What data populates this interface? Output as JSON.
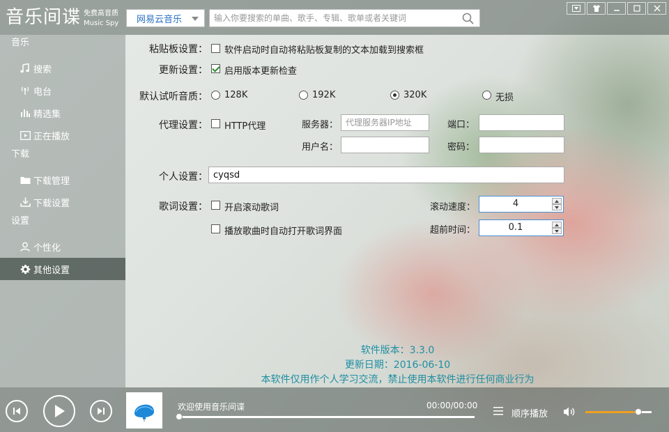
{
  "app": {
    "logo_main": "音乐间谍",
    "logo_sub1": "免费高音质",
    "logo_sub2": "Music Spy"
  },
  "header": {
    "source_selected": "网易云音乐",
    "search_placeholder": "输入你要搜索的单曲、歌手、专辑、歌单或者关键词"
  },
  "sidebar": {
    "sections": [
      {
        "title": "音乐",
        "items": [
          {
            "label": "搜索",
            "icon": "music-note-icon"
          },
          {
            "label": "电台",
            "icon": "radio-icon"
          },
          {
            "label": "精选集",
            "icon": "bars-icon"
          },
          {
            "label": "正在播放",
            "icon": "play-screen-icon"
          }
        ]
      },
      {
        "title": "下载",
        "items": [
          {
            "label": "下载管理",
            "icon": "folder-icon"
          },
          {
            "label": "下载设置",
            "icon": "download-icon"
          }
        ]
      },
      {
        "title": "设置",
        "items": [
          {
            "label": "个性化",
            "icon": "user-icon"
          },
          {
            "label": "其他设置",
            "icon": "gear-icon",
            "active": true
          }
        ]
      }
    ]
  },
  "settings": {
    "clipboard": {
      "label": "粘贴板设置：",
      "option": "软件启动时自动将粘贴板复制的文本加载到搜索框",
      "checked": false
    },
    "update": {
      "label": "更新设置：",
      "option": "启用版本更新检查",
      "checked": true
    },
    "quality": {
      "label": "默认试听音质：",
      "options": [
        "128K",
        "192K",
        "320K",
        "无损"
      ],
      "selected": "320K"
    },
    "proxy": {
      "label": "代理设置：",
      "option": "HTTP代理",
      "checked": false,
      "server_label": "服务器：",
      "server_placeholder": "代理服务器IP地址",
      "port_label": "端口：",
      "user_label": "用户名：",
      "password_label": "密码："
    },
    "personal": {
      "label": "个人设置：",
      "value": "cyqsd"
    },
    "lyrics": {
      "label": "歌词设置：",
      "scroll_option": "开启滚动歌词",
      "scroll_checked": false,
      "auto_open_option": "播放歌曲时自动打开歌词界面",
      "auto_open_checked": false,
      "speed_label": "滚动速度：",
      "speed_value": "4",
      "advance_label": "超前时间：",
      "advance_value": "0.1"
    }
  },
  "about": {
    "version": "软件版本：3.3.0",
    "date": "更新日期：2016-06-10",
    "notice": "本软件仅用作个人学习交流，禁止使用本软件进行任何商业行为"
  },
  "player": {
    "title": "欢迎使用音乐间谍",
    "time": "00:00/00:00",
    "progress": 0,
    "mode": "顺序播放",
    "volume": 0.8
  },
  "colors": {
    "accent": "#1f8fa2",
    "link": "#2a6fc0",
    "volume_fill": "#f0a020"
  }
}
